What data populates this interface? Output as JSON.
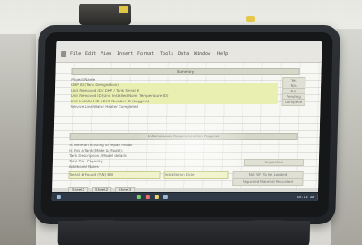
{
  "toolbar": {
    "items": [
      "File",
      "Edit",
      "View",
      "Insert",
      "Format",
      "Tools",
      "Data",
      "Window",
      "Help"
    ]
  },
  "sections": {
    "top_header": "Summary",
    "middle_header": "Informational Requirements in Progress"
  },
  "rows": [
    "Project Name",
    "DHP ID (Tank Designation)",
    "Unit Removed ID / DHP / Tank Serial #",
    "Unit Removed ID (Unit Installed Nom. Temperature ID)",
    "Unit Installed ID / DHP Number ID (Loggers)",
    "Service Line Water Heater Completed",
    "Is there an existing or repair install",
    "Is this a Tank (Make & Model):",
    "Tank Description / Model details",
    "Total Gal. Capacity:",
    "Additional Notes",
    "Serial # Found (Y/N) BIB",
    "Installation Date"
  ],
  "status": {
    "top_right_1": "Yes",
    "top_right_2": "N/A",
    "top_right_3": "N/A",
    "top_right_4": "Pending",
    "top_right_5": "Complete",
    "mid_right_1": "Inspection",
    "mid_right_2": "Not WF To Be Loaded",
    "mid_right_3": "Reported Material Recorded"
  },
  "tabs": [
    "Sheet1",
    "Sheet2",
    "Sheet3"
  ],
  "taskbar": {
    "tray_text": "10:24 AM"
  }
}
